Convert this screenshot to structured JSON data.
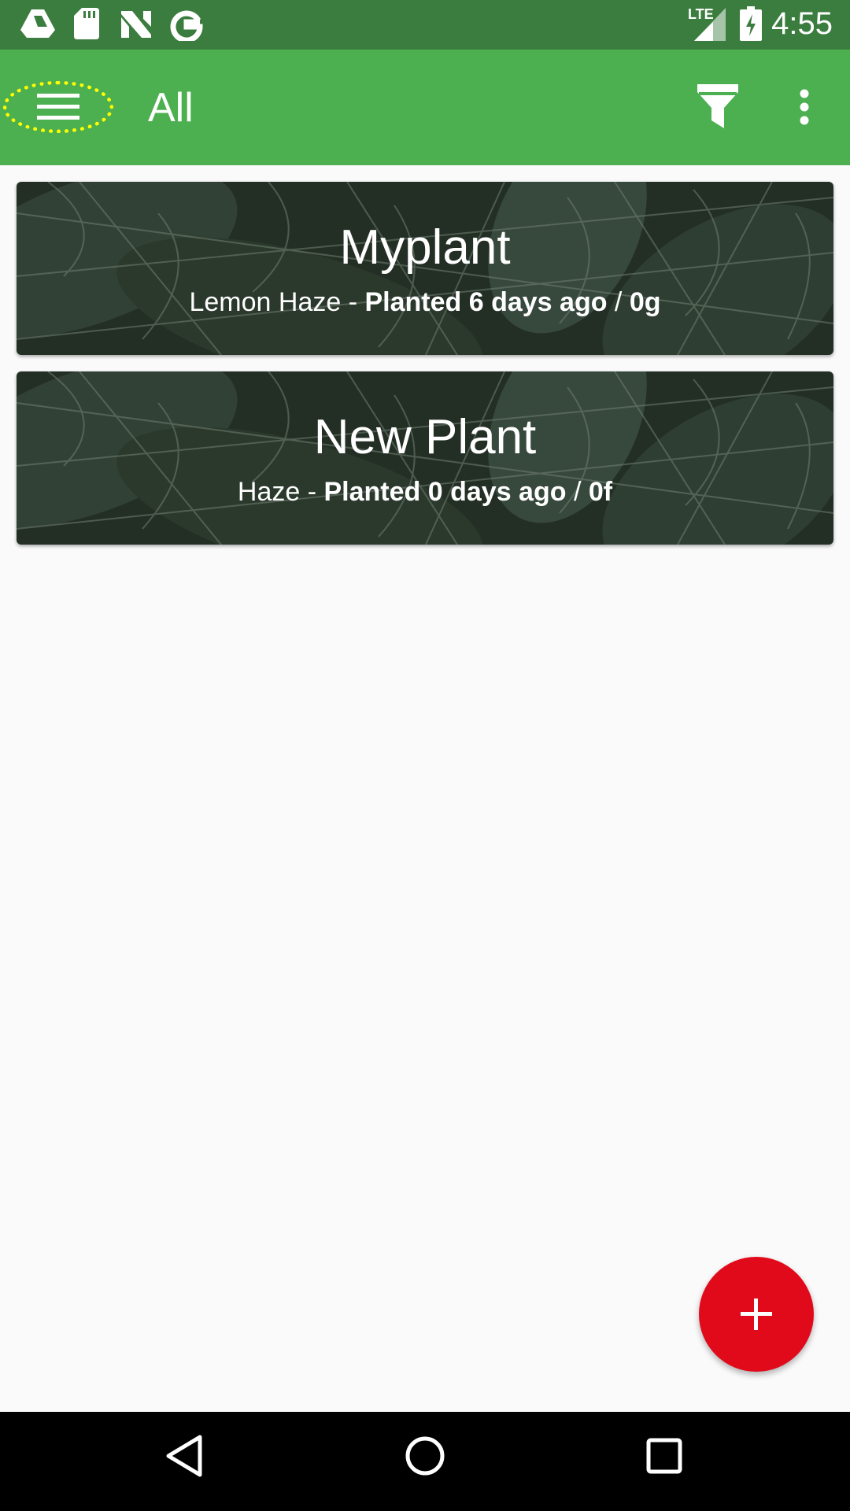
{
  "status_bar": {
    "time": "4:55",
    "network": "LTE",
    "icons": [
      "drive-icon",
      "sd-card-icon",
      "n-icon",
      "google-icon",
      "lte-signal-icon",
      "battery-charging-icon"
    ]
  },
  "app_bar": {
    "title": "All",
    "icons": [
      "menu-icon",
      "filter-icon",
      "more-vert-icon"
    ]
  },
  "plants": [
    {
      "name": "Myplant",
      "strain": "Lemon Haze",
      "separator": " - ",
      "planted": "Planted 6 days ago",
      "slash": " / ",
      "weight": "0g"
    },
    {
      "name": "New Plant",
      "strain": "Haze",
      "separator": " - ",
      "planted": "Planted 0 days ago",
      "slash": " / ",
      "weight": "0f"
    }
  ],
  "fab": {
    "icon": "plus-icon"
  },
  "nav_bar": {
    "icons": [
      "back-icon",
      "home-icon",
      "recents-icon"
    ]
  },
  "colors": {
    "status_bar": "#3b7d3e",
    "app_bar": "#4caf50",
    "fab": "#e10a1a",
    "highlight": "#ffff00"
  }
}
